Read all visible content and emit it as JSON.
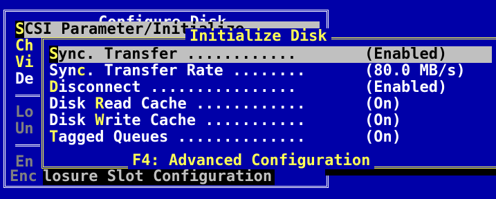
{
  "back_window": {
    "title": "Configure Disk",
    "items": [
      {
        "prefix": "S",
        "rest": "CSI Parameter/Initialize",
        "selected": true,
        "dim": false
      },
      {
        "prefix": "Ch",
        "rest": "",
        "selected": false,
        "dim": false
      },
      {
        "prefix": "Vi",
        "rest": "",
        "selected": false,
        "dim": false
      },
      {
        "prefix": "De",
        "rest": "",
        "selected": false,
        "dim": false
      },
      {
        "prefix": "Lo",
        "rest": "",
        "selected": false,
        "dim": true
      },
      {
        "prefix": "Un",
        "rest": "",
        "selected": false,
        "dim": true
      },
      {
        "prefix": "En",
        "rest": "",
        "selected": false,
        "dim": true
      },
      {
        "prefix": "Enc",
        "rest": "losure Slot Configuration",
        "selected": false,
        "dim": true
      }
    ]
  },
  "front_window": {
    "title": "Initialize Disk",
    "footer": "F4: Advanced Configuration",
    "rows": [
      {
        "pre": "",
        "hk": "S",
        "post": "ync. Transfer ............",
        "value": "(Enabled)",
        "selected": true
      },
      {
        "pre": "Syn",
        "hk": "c",
        "post": ". Transfer Rate ........",
        "value": "(80.0 MB/s)",
        "selected": false
      },
      {
        "pre": "",
        "hk": "D",
        "post": "isconnect ................",
        "value": "(Enabled)",
        "selected": false
      },
      {
        "pre": "Disk ",
        "hk": "R",
        "post": "ead Cache ............",
        "value": "(On)",
        "selected": false
      },
      {
        "pre": "Disk ",
        "hk": "W",
        "post": "rite Cache ...........",
        "value": "(On)",
        "selected": false
      },
      {
        "pre": "",
        "hk": "T",
        "post": "agged Queues ..............",
        "value": "(On)",
        "selected": false
      }
    ]
  },
  "colors": {
    "background": "#0000a8",
    "highlight_bar": "#c0c0c0",
    "hotkey": "#ffff55",
    "text": "#ffffff",
    "dim_text": "#808080"
  }
}
